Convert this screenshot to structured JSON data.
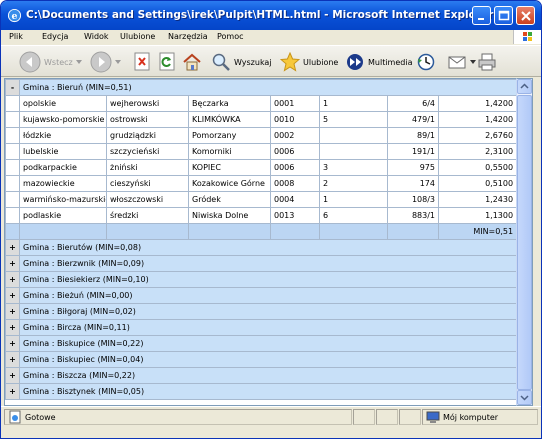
{
  "window": {
    "title": "C:\\Documents and Settings\\irek\\Pulpit\\HTML.html - Microsoft Internet Explorer",
    "minimize_icon": "minimize-icon",
    "maximize_icon": "maximize-icon",
    "close_icon": "close-icon"
  },
  "menu": [
    "Plik",
    "Edycja",
    "Widok",
    "Ulubione",
    "Narzędzia",
    "Pomoc"
  ],
  "toolbar": {
    "back_label": "Wstecz",
    "search_label": "Wyszukaj",
    "favorites_label": "Ulubione",
    "multimedia_label": "Multimedia"
  },
  "expanded_group": {
    "toggle": "-",
    "label": "Gmina : Bieruń (MIN=0,51)",
    "rows": [
      [
        "opolskie",
        "wejherowski",
        "Bęczarka",
        "0001",
        "1",
        "6/4",
        "1,4200"
      ],
      [
        "kujawsko-pomorskie",
        "ostrowski",
        "KLIMKÓWKA",
        "0010",
        "5",
        "479/1",
        "1,4200"
      ],
      [
        "łódzkie",
        "grudziądzki",
        "Pomorzany",
        "0002",
        "",
        "89/1",
        "2,6760"
      ],
      [
        "lubelskie",
        "szczycieński",
        "Komorniki",
        "0006",
        "",
        "191/1",
        "2,3100"
      ],
      [
        "podkarpackie",
        "żniński",
        "KOPIEC",
        "0006",
        "3",
        "975",
        "0,5500"
      ],
      [
        "mazowieckie",
        "cieszyński",
        "Kozakowice Górne",
        "0008",
        "2",
        "174",
        "0,5100"
      ],
      [
        "warmińsko-mazurskie",
        "włoszczowski",
        "Gródek",
        "0004",
        "1",
        "108/3",
        "1,2430"
      ],
      [
        "podlaskie",
        "średzki",
        "Niwiska Dolne",
        "0013",
        "6",
        "883/1",
        "1,1300"
      ]
    ],
    "summary": "MIN=0,51"
  },
  "collapsed_groups": [
    {
      "toggle": "+",
      "label": "Gmina : Bierutów (MIN=0,08)"
    },
    {
      "toggle": "+",
      "label": "Gmina : Bierzwnik (MIN=0,09)"
    },
    {
      "toggle": "+",
      "label": "Gmina : Biesiekierz (MIN=0,10)"
    },
    {
      "toggle": "+",
      "label": "Gmina : Bieżuń (MIN=0,00)"
    },
    {
      "toggle": "+",
      "label": "Gmina : Biłgoraj (MIN=0,02)"
    },
    {
      "toggle": "+",
      "label": "Gmina : Bircza (MIN=0,11)"
    },
    {
      "toggle": "+",
      "label": "Gmina : Biskupice (MIN=0,22)"
    },
    {
      "toggle": "+",
      "label": "Gmina : Biskupiec (MIN=0,04)"
    },
    {
      "toggle": "+",
      "label": "Gmina : Biszcza (MIN=0,22)"
    },
    {
      "toggle": "+",
      "label": "Gmina : Bisztynek (MIN=0,05)"
    }
  ],
  "status": {
    "left": "Gotowe",
    "zone": "Mój komputer"
  },
  "colors": {
    "titlebar": "#0a52d8",
    "group_row": "#c8e0f8",
    "grid_border": "#a7b9cf"
  }
}
